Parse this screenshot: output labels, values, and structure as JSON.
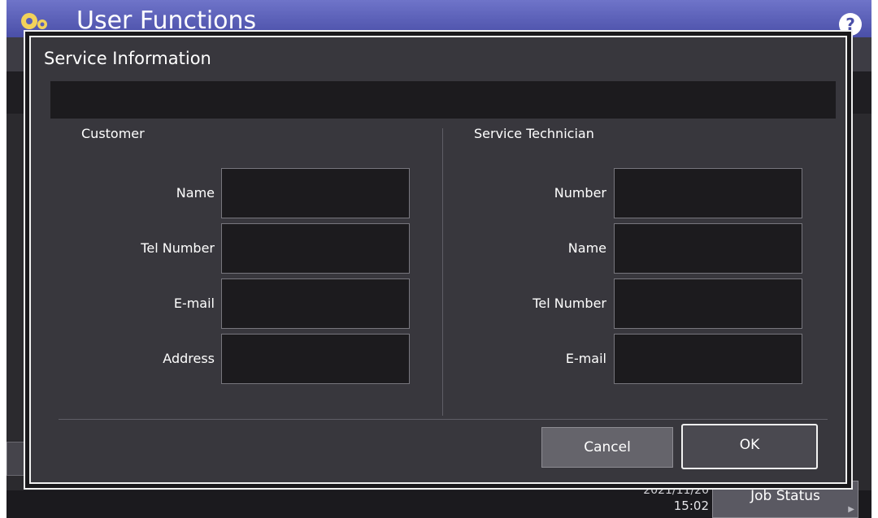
{
  "background": {
    "app_title": "User Functions",
    "help_symbol": "?",
    "date": "2021/11/20",
    "time": "15:02",
    "job_status_label": "Job Status"
  },
  "dialog": {
    "title": "Service Information",
    "customer": {
      "title": "Customer",
      "fields": [
        {
          "label": "Name",
          "value": ""
        },
        {
          "label": "Tel Number",
          "value": ""
        },
        {
          "label": "E-mail",
          "value": ""
        },
        {
          "label": "Address",
          "value": ""
        }
      ]
    },
    "technician": {
      "title": "Service Technician",
      "fields": [
        {
          "label": "Number",
          "value": ""
        },
        {
          "label": "Name",
          "value": ""
        },
        {
          "label": "Tel Number",
          "value": ""
        },
        {
          "label": "E-mail",
          "value": ""
        }
      ]
    },
    "buttons": {
      "cancel": "Cancel",
      "ok": "OK"
    }
  },
  "colors": {
    "header_accent": "#5a5fb8",
    "panel_background": "#38373d",
    "field_background": "#1c1b1e"
  },
  "icons": [
    "gear-icon",
    "help-icon",
    "chevron-right-icon"
  ]
}
